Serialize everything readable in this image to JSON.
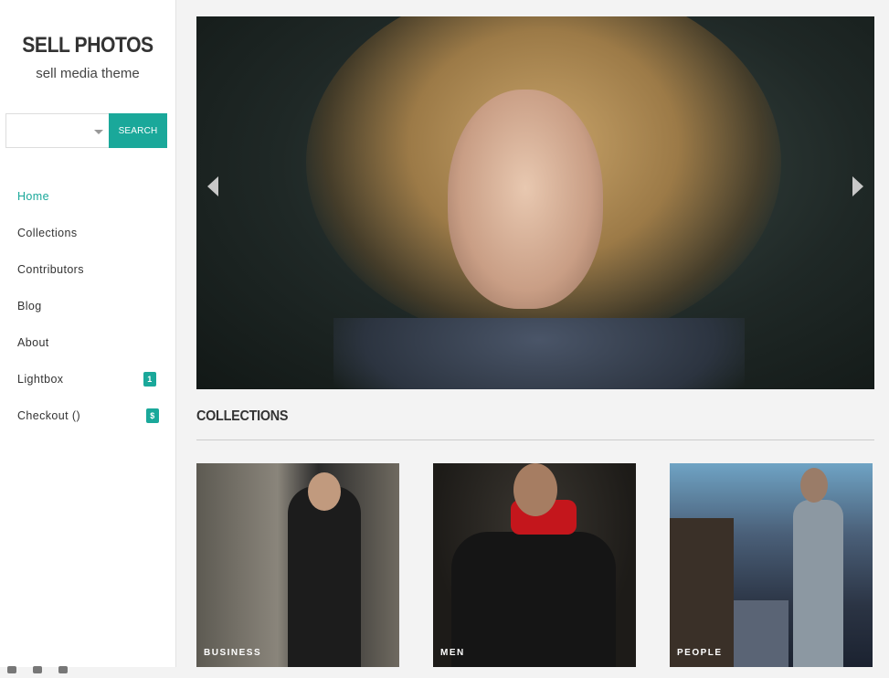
{
  "site": {
    "title": "SELL PHOTOS",
    "tagline": "sell media theme"
  },
  "search": {
    "button_label": "SEARCH",
    "select_value": ""
  },
  "nav": {
    "items": [
      {
        "label": "Home",
        "active": true
      },
      {
        "label": "Collections"
      },
      {
        "label": "Contributors"
      },
      {
        "label": "Blog"
      },
      {
        "label": "About"
      },
      {
        "label": "Lightbox",
        "badge": "1"
      },
      {
        "label": "Checkout ()",
        "badge": "$"
      }
    ]
  },
  "social_icons": [
    "facebook-icon",
    "twitter-icon",
    "pinterest-icon"
  ],
  "hero": {
    "prev_icon": "chevron-left-icon",
    "next_icon": "chevron-right-icon"
  },
  "collections": {
    "heading": "COLLECTIONS",
    "cards": [
      {
        "caption": "BUSINESS"
      },
      {
        "caption": "MEN"
      },
      {
        "caption": "PEOPLE"
      }
    ]
  },
  "colors": {
    "accent": "#1aa89a",
    "sidebar_bg": "#ffffff",
    "page_bg": "#f3f3f3"
  }
}
